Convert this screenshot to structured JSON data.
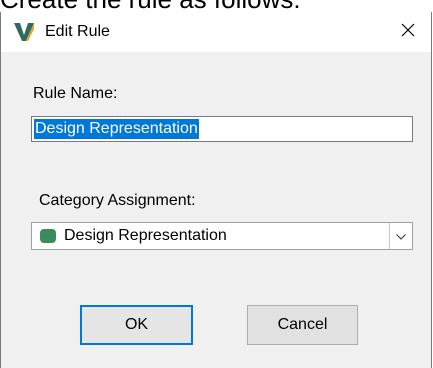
{
  "caption": "Create the rule as follows:",
  "dialog": {
    "title": "Edit Rule",
    "close_glyph": "×",
    "rule_name_label": "Rule Name:",
    "rule_name_value": "Design Representation",
    "category_label": "Category Assignment:",
    "category_value": "Design Representation",
    "category_color": "#3a8a5c",
    "ok_label": "OK",
    "cancel_label": "Cancel"
  },
  "icons": {
    "app": "vault-v-icon",
    "close": "close-icon",
    "dropdown": "chevron-down-icon"
  },
  "colors": {
    "accent": "#0078d7",
    "selection_text": "#ffffff"
  }
}
